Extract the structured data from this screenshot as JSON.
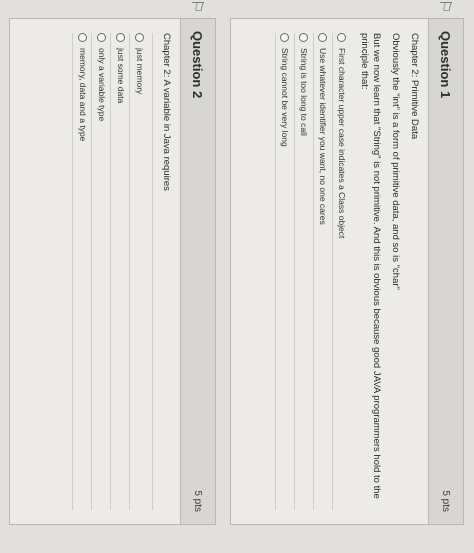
{
  "q1": {
    "title": "Question 1",
    "points": "5 pts",
    "lines": [
      "Chapter 2: Primitive Data",
      "Obviously the \"int\" is a form of primitive data, and so is \"char\"",
      "But we now learn that \"String\" is not primitive. And this is obvious because good JAVA programmers hold to the principle that:"
    ],
    "answers": [
      "First character upper case indicates a Class object",
      "Use whatever identifier you want, no one cares",
      "String is too long to call",
      "String cannot be very long"
    ]
  },
  "q2": {
    "title": "Question 2",
    "points": "5 pts",
    "lines": [
      "Chapter 2: A variable in Java requires"
    ],
    "answers": [
      "just memory",
      "just some data",
      "only a variable type",
      "memory, data and a type"
    ]
  }
}
